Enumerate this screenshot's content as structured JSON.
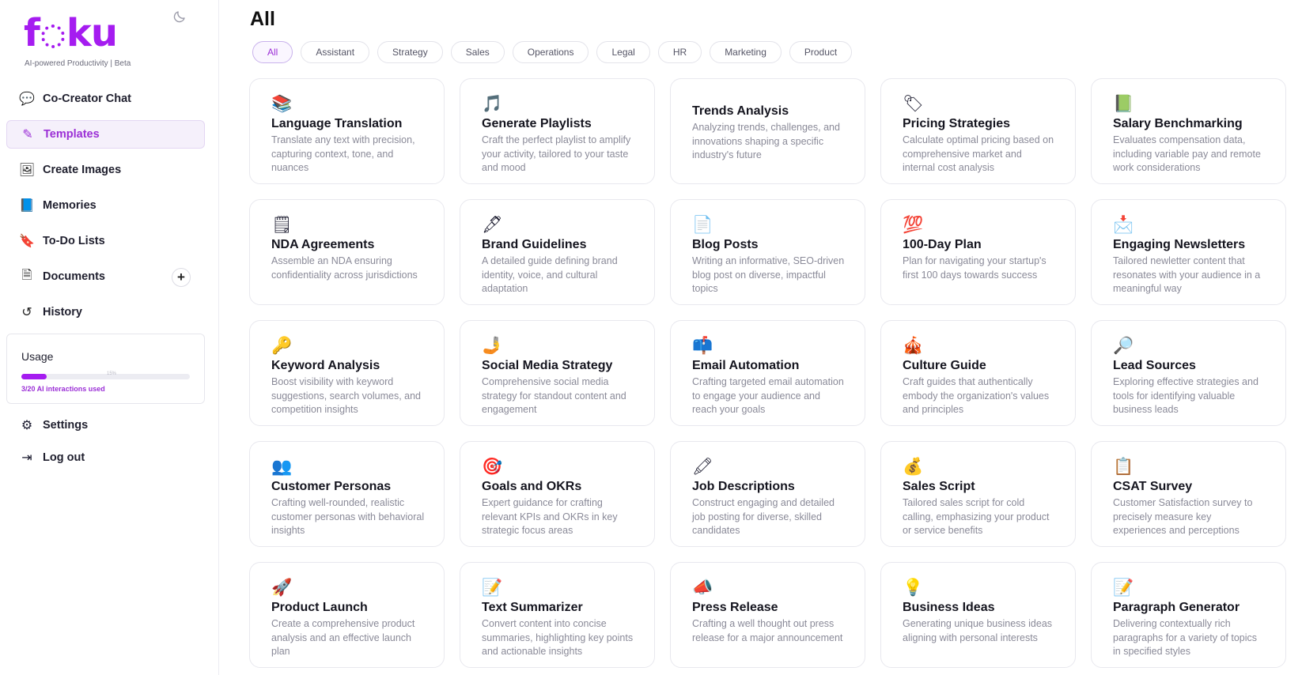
{
  "brand": {
    "logo": "foku",
    "tagline": "AI-powered Productivity | Beta"
  },
  "nav": [
    {
      "name": "nav-co-creator-chat",
      "icon": "chat-icon",
      "glyph": "💬",
      "label": "Co-Creator Chat",
      "active": false
    },
    {
      "name": "nav-templates",
      "icon": "edit-icon",
      "glyph": "✎",
      "label": "Templates",
      "active": true
    },
    {
      "name": "nav-create-images",
      "icon": "image-icon",
      "glyph": "🖼",
      "label": "Create Images",
      "active": false
    },
    {
      "name": "nav-memories",
      "icon": "book-icon",
      "glyph": "📘",
      "label": "Memories",
      "active": false
    },
    {
      "name": "nav-todo-lists",
      "icon": "bookmark-icon",
      "glyph": "🔖",
      "label": "To-Do Lists",
      "active": false
    },
    {
      "name": "nav-documents",
      "icon": "document-icon",
      "glyph": "🗎",
      "label": "Documents",
      "active": false
    },
    {
      "name": "nav-history",
      "icon": "history-icon",
      "glyph": "↺",
      "label": "History",
      "active": false
    }
  ],
  "documents_add": "+",
  "usage": {
    "title": "Usage",
    "percent_label": "15%",
    "fraction": 0.15,
    "note": "3/20 AI interactions used"
  },
  "nav_bottom": [
    {
      "name": "nav-settings",
      "icon": "settings-icon",
      "glyph": "⚙",
      "label": "Settings"
    },
    {
      "name": "nav-logout",
      "icon": "logout-icon",
      "glyph": "⇥",
      "label": "Log out"
    }
  ],
  "page": {
    "title": "All"
  },
  "filters": [
    "All",
    "Assistant",
    "Strategy",
    "Sales",
    "Operations",
    "Legal",
    "HR",
    "Marketing",
    "Product"
  ],
  "active_filter": "All",
  "colors": {
    "accent": "#a51cf0",
    "active_text": "#9b2fd6"
  },
  "templates": [
    {
      "icon": "books-icon",
      "glyph": "📚",
      "title": "Language Translation",
      "desc": "Translate any text with precision, capturing context, tone, and nuances"
    },
    {
      "icon": "music-icon",
      "glyph": "🎵",
      "title": "Generate Playlists",
      "desc": "Craft the perfect playlist to amplify your activity, tailored to your taste and mood"
    },
    {
      "icon": "",
      "glyph": "",
      "title": "Trends Analysis",
      "desc": "Analyzing trends, challenges, and innovations shaping a specific industry's future"
    },
    {
      "icon": "price-tag-icon",
      "glyph": "🏷",
      "title": "Pricing Strategies",
      "desc": "Calculate optimal pricing based on comprehensive market and internal cost analysis"
    },
    {
      "icon": "green-book-icon",
      "glyph": "📗",
      "title": "Salary Benchmarking",
      "desc": "Evaluates compensation data, including variable pay and remote work considerations"
    },
    {
      "icon": "notepad-icon",
      "glyph": "🗒",
      "title": "NDA Agreements",
      "desc": "Assemble an NDA ensuring confidentiality across jurisdictions"
    },
    {
      "icon": "pen-icon",
      "glyph": "🖋",
      "title": "Brand Guidelines",
      "desc": "A detailed guide defining brand identity, voice, and cultural adaptation"
    },
    {
      "icon": "page-icon",
      "glyph": "📄",
      "title": "Blog Posts",
      "desc": "Writing an informative, SEO-driven blog post on diverse, impactful topics"
    },
    {
      "icon": "hundred-icon",
      "glyph": "💯",
      "title": "100-Day Plan",
      "desc": "Plan for navigating your startup's first 100 days towards success"
    },
    {
      "icon": "envelope-icon",
      "glyph": "📩",
      "title": "Engaging Newsletters",
      "desc": "Tailored newletter content that resonates with your audience in a meaningful way"
    },
    {
      "icon": "key-icon",
      "glyph": "🔑",
      "title": "Keyword Analysis",
      "desc": "Boost visibility with keyword suggestions, search volumes, and competition insights"
    },
    {
      "icon": "megaphone-hand-icon",
      "glyph": "🤳",
      "title": "Social Media Strategy",
      "desc": "Comprehensive social media strategy for standout content and engagement"
    },
    {
      "icon": "mailbox-icon",
      "glyph": "📫",
      "title": "Email Automation",
      "desc": "Crafting targeted email automation to engage your audience and reach your goals"
    },
    {
      "icon": "circus-tent-icon",
      "glyph": "🎪",
      "title": "Culture Guide",
      "desc": "Craft guides that authentically embody the organization's values and principles"
    },
    {
      "icon": "magnifier-icon",
      "glyph": "🔎",
      "title": "Lead Sources",
      "desc": "Exploring effective strategies and tools for identifying valuable business leads"
    },
    {
      "icon": "people-icon",
      "glyph": "👥",
      "title": "Customer Personas",
      "desc": "Crafting well-rounded, realistic customer personas with behavioral insights"
    },
    {
      "icon": "target-icon",
      "glyph": "🎯",
      "title": "Goals and OKRs",
      "desc": "Expert guidance for crafting relevant KPIs and OKRs in key strategic focus areas"
    },
    {
      "icon": "marker-icon",
      "glyph": "🖍",
      "title": "Job Descriptions",
      "desc": "Construct engaging and detailed job posting for diverse, skilled candidates"
    },
    {
      "icon": "money-bag-icon",
      "glyph": "💰",
      "title": "Sales Script",
      "desc": "Tailored sales script for cold calling, emphasizing your product or service benefits"
    },
    {
      "icon": "clipboard-icon",
      "glyph": "📋",
      "title": "CSAT Survey",
      "desc": "Customer Satisfaction survey to precisely measure key experiences and perceptions"
    },
    {
      "icon": "rocket-icon",
      "glyph": "🚀",
      "title": "Product Launch",
      "desc": "Create a comprehensive product analysis and an effective launch plan"
    },
    {
      "icon": "document-pen-icon",
      "glyph": "📝",
      "title": "Text Summarizer",
      "desc": "Convert content into concise summaries, highlighting key points and actionable insights"
    },
    {
      "icon": "megaphone-icon",
      "glyph": "📣",
      "title": "Press Release",
      "desc": "Crafting a well thought out press release for a major announcement"
    },
    {
      "icon": "lightbulb-icon",
      "glyph": "💡",
      "title": "Business Ideas",
      "desc": "Generating unique business ideas aligning with personal interests"
    },
    {
      "icon": "memo-icon",
      "glyph": "📝",
      "title": "Paragraph Generator",
      "desc": "Delivering contextually rich paragraphs for a variety of topics in specified styles"
    }
  ]
}
